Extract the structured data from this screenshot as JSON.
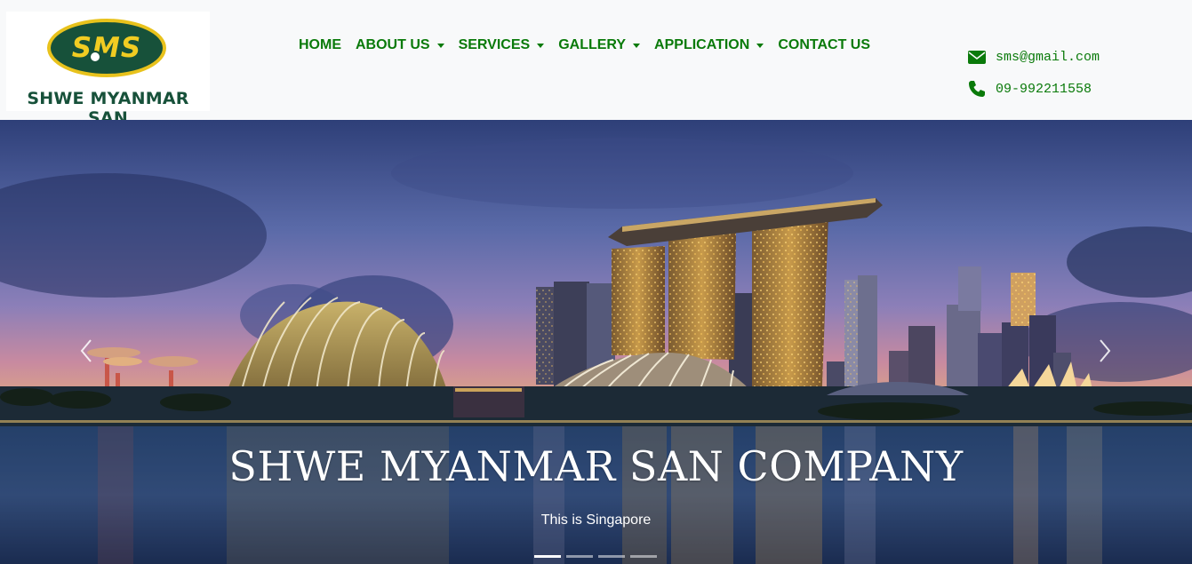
{
  "brand": {
    "logo_text": "SMS",
    "name": "SHWE MYANMAR SAN"
  },
  "nav": {
    "items": [
      {
        "label": "HOME",
        "dropdown": false
      },
      {
        "label": "ABOUT US",
        "dropdown": true
      },
      {
        "label": "SERVICES",
        "dropdown": true
      },
      {
        "label": "GALLERY",
        "dropdown": true
      },
      {
        "label": "APPLICATION",
        "dropdown": true
      },
      {
        "label": "CONTACT US",
        "dropdown": false
      }
    ]
  },
  "contact": {
    "email": "sms@gmail.com",
    "phone": "09-992211558",
    "email_icon": "envelope-icon",
    "phone_icon": "phone-icon"
  },
  "carousel": {
    "title": "SHWE MYANMAR SAN COMPANY",
    "subtitle": "This is Singapore",
    "slide_count": 4,
    "active_slide": 1,
    "prev_icon": "chevron-left-icon",
    "next_icon": "chevron-right-icon"
  },
  "colors": {
    "nav_text": "#0a7a0a",
    "brand_green": "#17513a",
    "brand_gold": "#e8c21c",
    "header_bg": "#f8f9fa"
  }
}
